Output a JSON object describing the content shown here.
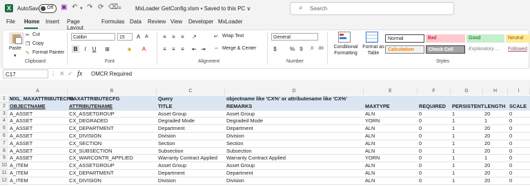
{
  "titlebar": {
    "autosave_label": "AutoSave",
    "autosave_state": "Off",
    "doc_title": "MxLoader GetConfig.xlsm  •  Saved to this PC  ∨",
    "search_placeholder": "Search"
  },
  "tabs": [
    "File",
    "Home",
    "Insert",
    "Page Layout",
    "Formulas",
    "Data",
    "Review",
    "View",
    "Developer",
    "MxLoader"
  ],
  "ribbon": {
    "clipboard": {
      "paste": "Paste",
      "cut": "Cut",
      "copy": "Copy",
      "format_painter": "Format Painter",
      "label": "Clipboard"
    },
    "font": {
      "name": "Calibri",
      "size": "15",
      "label": "Font"
    },
    "alignment": {
      "wrap_text": "Wrap Text",
      "merge_center": "Merge & Center",
      "label": "Alignment"
    },
    "number": {
      "format": "General",
      "label": "Number"
    },
    "styles": {
      "conditional_formatting": "Conditional Formatting",
      "format_as_table": "Format as Table",
      "normal": "Normal",
      "bad": "Bad",
      "good": "Good",
      "neutral": "Neutral",
      "calculation": "Calculation",
      "check_cell": "Check Cell",
      "explanatory": "Explanatory ...",
      "followed": "Followed",
      "label": "Styles"
    }
  },
  "formula_bar": {
    "name_box": "C17",
    "fx": "fx",
    "formula": "OMCR Required"
  },
  "columns": [
    "A",
    "B",
    "C",
    "D",
    "E",
    "F",
    "G",
    "H",
    "I"
  ],
  "rows": [
    {
      "num": "1",
      "cells": [
        "MXL_MAXATTRIBUTECFG",
        "MAXATTRIBUTECFG",
        "Query",
        "objectname like 'CX%' or attributename like 'CX%'",
        "",
        "",
        "",
        "",
        ""
      ]
    },
    {
      "num": "2",
      "cells": [
        "OBJECTNAME",
        "ATTRIBUTENAME",
        "TITLE",
        "REMARKS",
        "MAXTYPE",
        "REQUIRED",
        "PERSISTENT",
        "LENGTH",
        "SCALE"
      ]
    },
    {
      "num": "3",
      "cells": [
        "A_ASSET",
        "CX_ASSETGROUP",
        "Asset Group",
        "Asset Group",
        "ALN",
        "0",
        "1",
        "20",
        "0"
      ]
    },
    {
      "num": "4",
      "cells": [
        "A_ASSET",
        "CX_DEGRADED",
        "Degraded Mode",
        "Degraded Mode",
        "YORN",
        "0",
        "1",
        "1",
        "0"
      ]
    },
    {
      "num": "5",
      "cells": [
        "A_ASSET",
        "CX_DEPARTMENT",
        "Department",
        "Department",
        "ALN",
        "0",
        "1",
        "20",
        "0"
      ]
    },
    {
      "num": "6",
      "cells": [
        "A_ASSET",
        "CX_DIVISION",
        "Division",
        "Division",
        "ALN",
        "0",
        "1",
        "20",
        "0"
      ]
    },
    {
      "num": "7",
      "cells": [
        "A_ASSET",
        "CX_SECTION",
        "Section",
        "Section",
        "ALN",
        "0",
        "1",
        "20",
        "0"
      ]
    },
    {
      "num": "8",
      "cells": [
        "A_ASSET",
        "CX_SUBSECTION",
        "Subsection",
        "Subsection",
        "ALN",
        "0",
        "1",
        "20",
        "0"
      ]
    },
    {
      "num": "9",
      "cells": [
        "A_ASSET",
        "CX_WARCONTR_APPLIED",
        "Warranty Contract Applied",
        "Warranty Contract Applied",
        "YORN",
        "0",
        "1",
        "1",
        "0"
      ]
    },
    {
      "num": "10",
      "cells": [
        "A_ITEM",
        "CX_ASSETGROUP",
        "Asset Group",
        "Asset Group",
        "ALN",
        "0",
        "1",
        "20",
        "0"
      ]
    },
    {
      "num": "11",
      "cells": [
        "A_ITEM",
        "CX_DEPARTMENT",
        "Department",
        "Department",
        "ALN",
        "0",
        "1",
        "20",
        "0"
      ]
    },
    {
      "num": "12",
      "cells": [
        "A_ITEM",
        "CX_DIVISION",
        "Division",
        "Division",
        "ALN",
        "0",
        "1",
        "20",
        "0"
      ]
    }
  ]
}
